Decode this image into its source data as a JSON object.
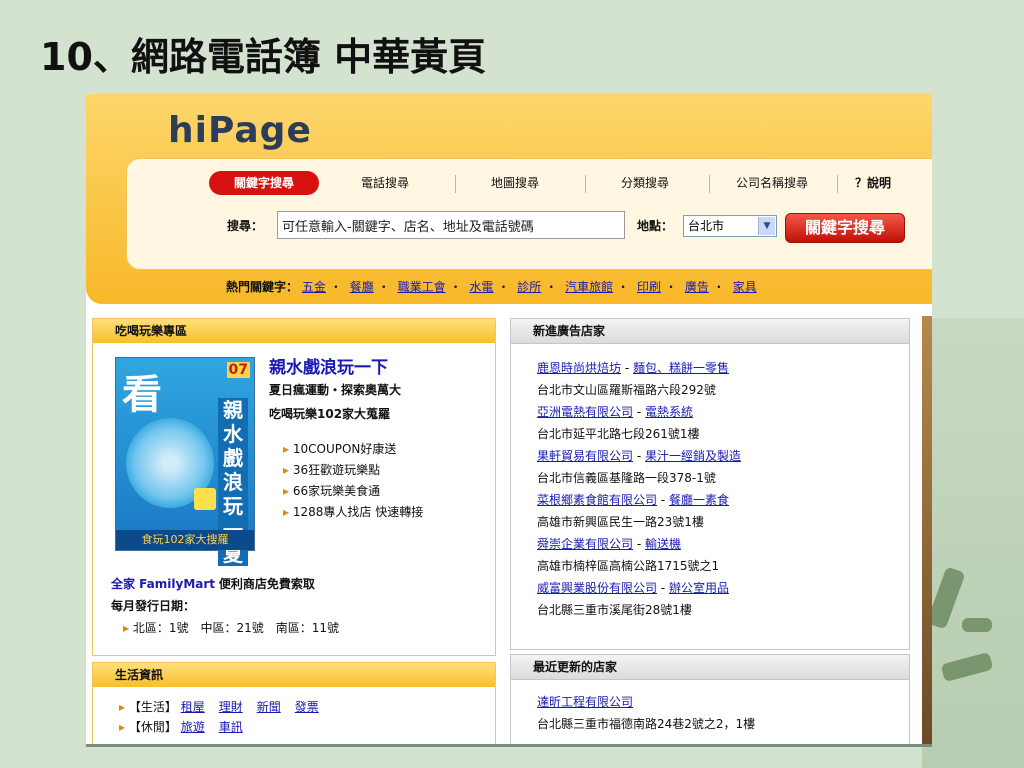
{
  "slide_title": "10、網路電話簿  中華黃頁",
  "logo": "hiPage",
  "tabs": [
    {
      "label": "關鍵字搜尋",
      "active": true
    },
    {
      "label": "電話搜尋"
    },
    {
      "label": "地圖搜尋"
    },
    {
      "label": "分類搜尋"
    },
    {
      "label": "公司名稱搜尋"
    },
    {
      "label": "？說明"
    }
  ],
  "search": {
    "label": "搜尋：",
    "value": "可任意輸入-關鍵字、店名、地址及電話號碼",
    "location_label": "地點：",
    "location_value": "台北市",
    "button": "關鍵字搜尋"
  },
  "hot": {
    "label": "熱門關鍵字：",
    "keywords": [
      "五金",
      "餐廳",
      "職業工會",
      "水電",
      "診所",
      "汽車旅館",
      "印刷",
      "廣告",
      "家具"
    ]
  },
  "fun_box": {
    "header": "吃喝玩樂專區",
    "magazine": {
      "big_char": "看",
      "issue": "07",
      "vertical": "親水戲浪玩一夏",
      "band": "食玩102家大搜羅"
    },
    "title": "親水戲浪玩一下",
    "subtitles": [
      "夏日瘋運動・探索奧萬大",
      "吃喝玩樂102家大蒐羅"
    ],
    "items": [
      "10COUPON好康送",
      "36狂歡遊玩樂點",
      "66家玩樂美食通",
      "1288專人找店 快速轉接"
    ],
    "familymart": "全家 FamilyMart",
    "familymart_note": "便利商店免費索取",
    "date_label": "每月發行日期：",
    "dates": "北區：1號　中區：21號　南區：11號"
  },
  "new_ads": {
    "header": "新進廣告店家",
    "entries": [
      {
        "company": "鹿恩時尚烘焙坊",
        "category": "麵包、糕餅一零售",
        "address": "台北市文山區羅斯福路六段292號"
      },
      {
        "company": "亞洲電熱有限公司",
        "category": "電熱系統",
        "address": "台北市延平北路七段261號1樓"
      },
      {
        "company": "果軒貿易有限公司",
        "category": "果汁一經銷及製造",
        "address": "台北市信義區基隆路一段378-1號"
      },
      {
        "company": "菜根鄉素食館有限公司",
        "category": "餐廳一素食",
        "address": "高雄市新興區民生一路23號1樓"
      },
      {
        "company": "舜崇企業有限公司",
        "category": "輸送機",
        "address": "高雄市楠梓區高楠公路1715號之1"
      },
      {
        "company": "威富興業股份有限公司",
        "category": "辦公室用品",
        "address": "台北縣三重市溪尾街28號1樓"
      }
    ]
  },
  "life_box": {
    "header": "生活資訊",
    "rows": [
      {
        "label": "【生活】",
        "links": [
          "租屋",
          "理財",
          "新聞",
          "發票"
        ]
      },
      {
        "label": "【休閒】",
        "links": [
          "旅遊",
          "車訊"
        ]
      }
    ]
  },
  "recent": {
    "header": "最近更新的店家",
    "entries": [
      {
        "company": "達昕工程有限公司",
        "address": "台北縣三重市福德南路24巷2號之2，1樓"
      }
    ]
  },
  "colors": {
    "slide_bg": "#d3e3cf",
    "header_yellow": "#f8b828",
    "accent_red": "#d6120f",
    "link_blue": "#1a1ab3"
  }
}
